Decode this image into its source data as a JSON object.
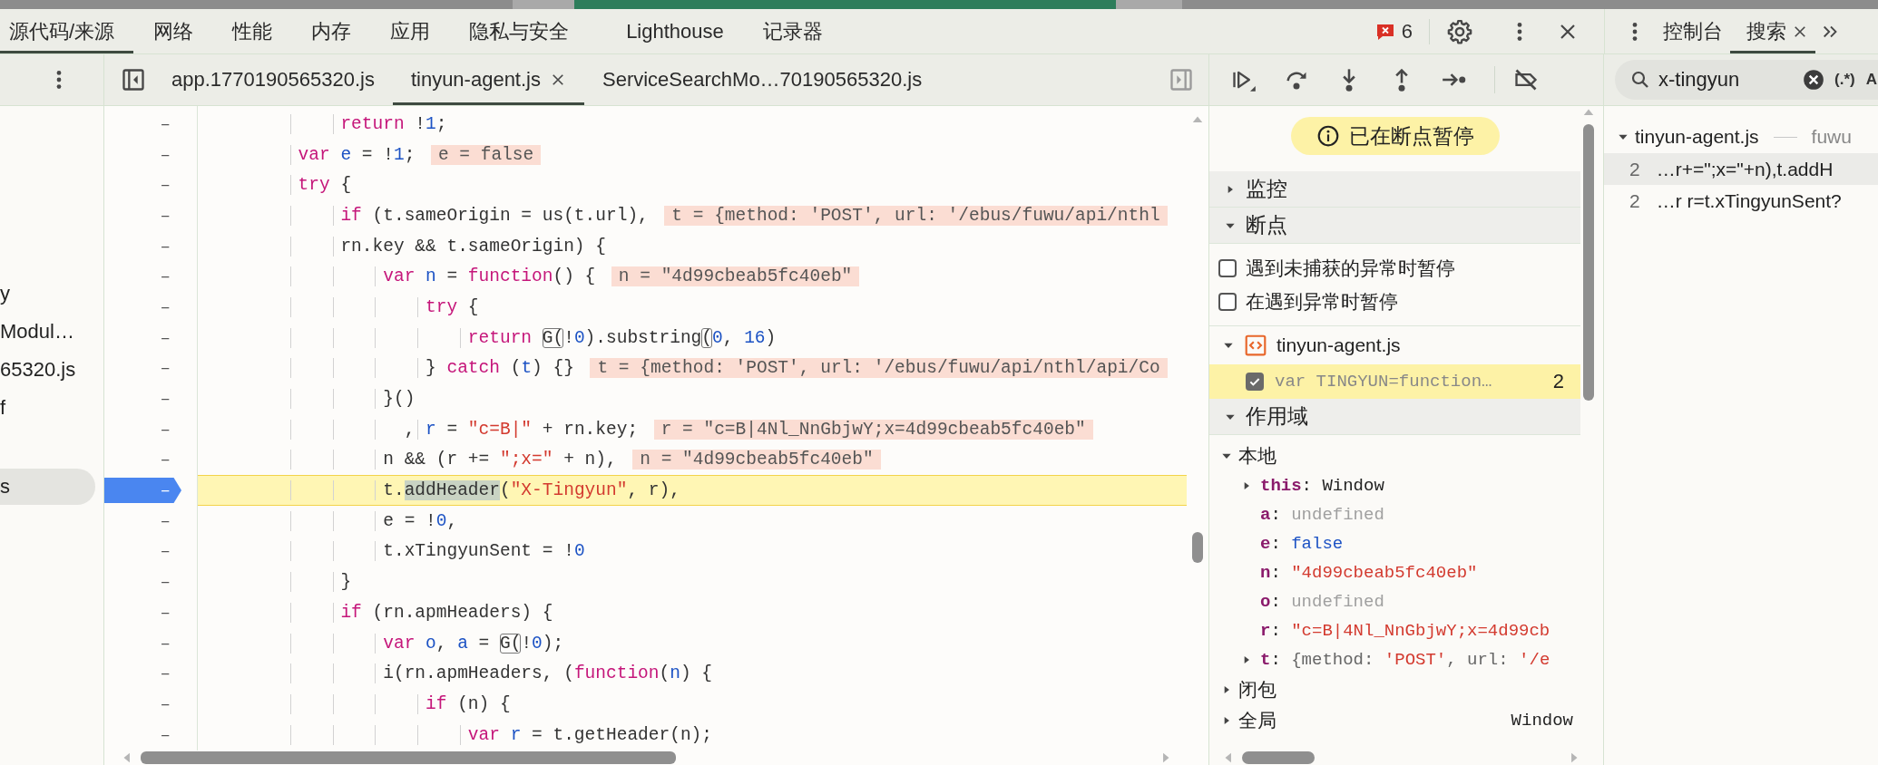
{
  "main_tabs": [
    {
      "label": "源代码/来源",
      "selected": true
    },
    {
      "label": "网络",
      "selected": false
    },
    {
      "label": "性能",
      "selected": false
    },
    {
      "label": "内存",
      "selected": false
    },
    {
      "label": "应用",
      "selected": false
    },
    {
      "label": "隐私与安全",
      "selected": false
    },
    {
      "label": "Lighthouse",
      "selected": false
    },
    {
      "label": "记录器",
      "selected": false
    }
  ],
  "error_count": "6",
  "drawer_tabs": [
    {
      "label": "控制台",
      "selected": false,
      "closable": false
    },
    {
      "label": "搜索",
      "selected": true,
      "closable": true
    }
  ],
  "navigator": {
    "items": [
      {
        "label": "y",
        "selected": false
      },
      {
        "label": "Modul…",
        "selected": false
      },
      {
        "label": "65320.js",
        "selected": false
      },
      {
        "label": "f",
        "selected": false
      },
      {
        "label": "s",
        "selected": true
      }
    ]
  },
  "file_tabs": [
    {
      "label": "app.1770190565320.js",
      "selected": false,
      "closable": false
    },
    {
      "label": "tinyun-agent.js",
      "selected": true,
      "closable": true
    },
    {
      "label": "ServiceSearchMo…70190565320.js",
      "selected": false,
      "closable": false
    }
  ],
  "code": {
    "lines": [
      {
        "marker": "–",
        "breakpoint": false,
        "current": false,
        "tokens": [
          {
            "kind": "kw",
            "text": "            return"
          },
          {
            "kind": "plain",
            "text": " !"
          },
          {
            "kind": "num",
            "text": "1"
          },
          {
            "kind": "plain",
            "text": ";"
          }
        ]
      },
      {
        "marker": "–",
        "breakpoint": false,
        "current": false,
        "tokens": [
          {
            "kind": "kw",
            "text": "        var "
          },
          {
            "kind": "var",
            "text": "e"
          },
          {
            "kind": "plain",
            "text": " = !"
          },
          {
            "kind": "num",
            "text": "1"
          },
          {
            "kind": "plain",
            "text": ";"
          }
        ],
        "inline_value": "e = false"
      },
      {
        "marker": "–",
        "breakpoint": false,
        "current": false,
        "tokens": [
          {
            "kind": "kw",
            "text": "        try"
          },
          {
            "kind": "plain",
            "text": " {"
          }
        ]
      },
      {
        "marker": "–",
        "breakpoint": false,
        "current": false,
        "tokens": [
          {
            "kind": "kw",
            "text": "            if"
          },
          {
            "kind": "plain",
            "text": " (t.sameOrigin = us(t.url),"
          }
        ],
        "inline_value": "t = {method: 'POST', url: '/ebus/fuwu/api/nthl"
      },
      {
        "marker": "–",
        "breakpoint": false,
        "current": false,
        "tokens": [
          {
            "kind": "plain",
            "text": "            rn.key && t.sameOrigin) {"
          }
        ]
      },
      {
        "marker": "–",
        "breakpoint": false,
        "current": false,
        "tokens": [
          {
            "kind": "kw",
            "text": "                var "
          },
          {
            "kind": "var",
            "text": "n"
          },
          {
            "kind": "plain",
            "text": " = "
          },
          {
            "kind": "kw",
            "text": "function"
          },
          {
            "kind": "plain",
            "text": "() {"
          }
        ],
        "inline_value": "n = \"4d99cbeab5fc40eb\""
      },
      {
        "marker": "–",
        "breakpoint": false,
        "current": false,
        "tokens": [
          {
            "kind": "kw",
            "text": "                    try"
          },
          {
            "kind": "plain",
            "text": " {"
          }
        ]
      },
      {
        "marker": "–",
        "breakpoint": false,
        "current": false,
        "tokens": [
          {
            "kind": "kw",
            "text": "                        return "
          },
          {
            "kind": "stop",
            "text": "G("
          },
          {
            "kind": "plain",
            "text": "!"
          },
          {
            "kind": "num",
            "text": "0"
          },
          {
            "kind": "plain",
            "text": ").substring"
          },
          {
            "kind": "stop",
            "text": "("
          },
          {
            "kind": "num",
            "text": "0"
          },
          {
            "kind": "plain",
            "text": ", "
          },
          {
            "kind": "num",
            "text": "16"
          },
          {
            "kind": "plain",
            "text": ")"
          }
        ]
      },
      {
        "marker": "–",
        "breakpoint": false,
        "current": false,
        "tokens": [
          {
            "kind": "plain",
            "text": "                    } "
          },
          {
            "kind": "kw",
            "text": "catch"
          },
          {
            "kind": "plain",
            "text": " ("
          },
          {
            "kind": "var",
            "text": "t"
          },
          {
            "kind": "plain",
            "text": ") {}"
          }
        ],
        "inline_value": "t = {method: 'POST', url: '/ebus/fuwu/api/nthl/api/Co"
      },
      {
        "marker": "–",
        "breakpoint": false,
        "current": false,
        "tokens": [
          {
            "kind": "plain",
            "text": "                }()"
          }
        ]
      },
      {
        "marker": "–",
        "breakpoint": false,
        "current": false,
        "tokens": [
          {
            "kind": "plain",
            "text": "                  , "
          },
          {
            "kind": "var",
            "text": "r"
          },
          {
            "kind": "plain",
            "text": " = "
          },
          {
            "kind": "str",
            "text": "\"c=B|\""
          },
          {
            "kind": "plain",
            "text": " + rn.key;"
          }
        ],
        "inline_value": "r = \"c=B|4Nl_NnGbjwY;x=4d99cbeab5fc40eb\""
      },
      {
        "marker": "–",
        "breakpoint": false,
        "current": false,
        "tokens": [
          {
            "kind": "plain",
            "text": "                n && (r += "
          },
          {
            "kind": "str",
            "text": "\";x=\""
          },
          {
            "kind": "plain",
            "text": " + n),"
          }
        ],
        "inline_value": "n = \"4d99cbeab5fc40eb\""
      },
      {
        "marker": "–",
        "breakpoint": true,
        "current": true,
        "tokens": [
          {
            "kind": "plain",
            "text": "                t."
          },
          {
            "kind": "match",
            "text": "addHeader"
          },
          {
            "kind": "plain",
            "text": "("
          },
          {
            "kind": "str",
            "text": "\"X-Tingyun\""
          },
          {
            "kind": "plain",
            "text": ", r),"
          }
        ]
      },
      {
        "marker": "–",
        "breakpoint": false,
        "current": false,
        "tokens": [
          {
            "kind": "plain",
            "text": "                e = !"
          },
          {
            "kind": "num",
            "text": "0"
          },
          {
            "kind": "plain",
            "text": ","
          }
        ]
      },
      {
        "marker": "–",
        "breakpoint": false,
        "current": false,
        "tokens": [
          {
            "kind": "plain",
            "text": "                t.xTingyunSent = !"
          },
          {
            "kind": "num",
            "text": "0"
          }
        ]
      },
      {
        "marker": "–",
        "breakpoint": false,
        "current": false,
        "tokens": [
          {
            "kind": "plain",
            "text": "            }"
          }
        ]
      },
      {
        "marker": "–",
        "breakpoint": false,
        "current": false,
        "tokens": [
          {
            "kind": "kw",
            "text": "            if"
          },
          {
            "kind": "plain",
            "text": " (rn.apmHeaders) {"
          }
        ]
      },
      {
        "marker": "–",
        "breakpoint": false,
        "current": false,
        "tokens": [
          {
            "kind": "kw",
            "text": "                var "
          },
          {
            "kind": "var",
            "text": "o"
          },
          {
            "kind": "plain",
            "text": ", "
          },
          {
            "kind": "var",
            "text": "a"
          },
          {
            "kind": "plain",
            "text": " = "
          },
          {
            "kind": "stop",
            "text": "G("
          },
          {
            "kind": "plain",
            "text": "!"
          },
          {
            "kind": "num",
            "text": "0"
          },
          {
            "kind": "plain",
            "text": ");"
          }
        ]
      },
      {
        "marker": "–",
        "breakpoint": false,
        "current": false,
        "tokens": [
          {
            "kind": "plain",
            "text": "                i(rn.apmHeaders, ("
          },
          {
            "kind": "kw",
            "text": "function"
          },
          {
            "kind": "plain",
            "text": "("
          },
          {
            "kind": "var",
            "text": "n"
          },
          {
            "kind": "plain",
            "text": ") {"
          }
        ]
      },
      {
        "marker": "–",
        "breakpoint": false,
        "current": false,
        "tokens": [
          {
            "kind": "kw",
            "text": "                    if"
          },
          {
            "kind": "plain",
            "text": " (n) {"
          }
        ]
      },
      {
        "marker": "–",
        "breakpoint": false,
        "current": false,
        "tokens": [
          {
            "kind": "kw",
            "text": "                        var "
          },
          {
            "kind": "var",
            "text": "r"
          },
          {
            "kind": "plain",
            "text": " = t.getHeader(n);"
          }
        ]
      }
    ]
  },
  "debugger": {
    "paused_banner": "已在断点暂停",
    "sections": [
      {
        "kind": "watch",
        "title": "监控",
        "expanded": false
      },
      {
        "kind": "breakpoints",
        "title": "断点",
        "expanded": true,
        "options": [
          {
            "label": "遇到未捕获的异常时暂停",
            "checked": false
          },
          {
            "label": "在遇到异常时暂停",
            "checked": false
          }
        ],
        "files": [
          {
            "name": "tinyun-agent.js",
            "expanded": true,
            "breakpoints": [
              {
                "code": "var TINGYUN=function…",
                "line": "2",
                "checked": true,
                "hit": true
              }
            ]
          }
        ]
      },
      {
        "kind": "scope",
        "title": "作用域",
        "expanded": true,
        "groups": [
          {
            "title": "本地",
            "expanded": true,
            "variables": [
              {
                "name": "this",
                "separator": ":",
                "kind": "object",
                "value": "Window",
                "expandable": true
              },
              {
                "name": "a",
                "separator": ":",
                "kind": "undefined",
                "value": "undefined",
                "expandable": false
              },
              {
                "name": "e",
                "separator": ":",
                "kind": "boolean",
                "value": "false",
                "expandable": false
              },
              {
                "name": "n",
                "separator": ":",
                "kind": "string",
                "value": "\"4d99cbeab5fc40eb\"",
                "expandable": false
              },
              {
                "name": "o",
                "separator": ":",
                "kind": "undefined",
                "value": "undefined",
                "expandable": false
              },
              {
                "name": "r",
                "separator": ":",
                "kind": "string",
                "value": "\"c=B|4Nl_NnGbjwY;x=4d99cb",
                "expandable": false
              },
              {
                "name": "t",
                "separator": ":",
                "kind": "preview",
                "tokens": [
                  {
                    "kind": "plain",
                    "text": "{method: "
                  },
                  {
                    "kind": "str",
                    "text": "'POST'"
                  },
                  {
                    "kind": "plain",
                    "text": ", url: "
                  },
                  {
                    "kind": "str",
                    "text": "'/e"
                  }
                ],
                "expandable": true
              }
            ]
          },
          {
            "title": "闭包",
            "expanded": false
          },
          {
            "title": "全局",
            "expanded": false,
            "value": "Window"
          }
        ]
      }
    ]
  },
  "search": {
    "query": "x-tingyun",
    "regex_toggle": "(.*)",
    "case_toggle": "A",
    "results": [
      {
        "file": "tinyun-agent.js",
        "path": "fuwu",
        "expanded": true,
        "matches": [
          {
            "line": "2",
            "text": "…r+=\";x=\"+n),t.addH",
            "selected": true
          },
          {
            "line": "2",
            "text": "…r r=t.xTingyunSent?",
            "selected": false
          }
        ]
      }
    ]
  }
}
